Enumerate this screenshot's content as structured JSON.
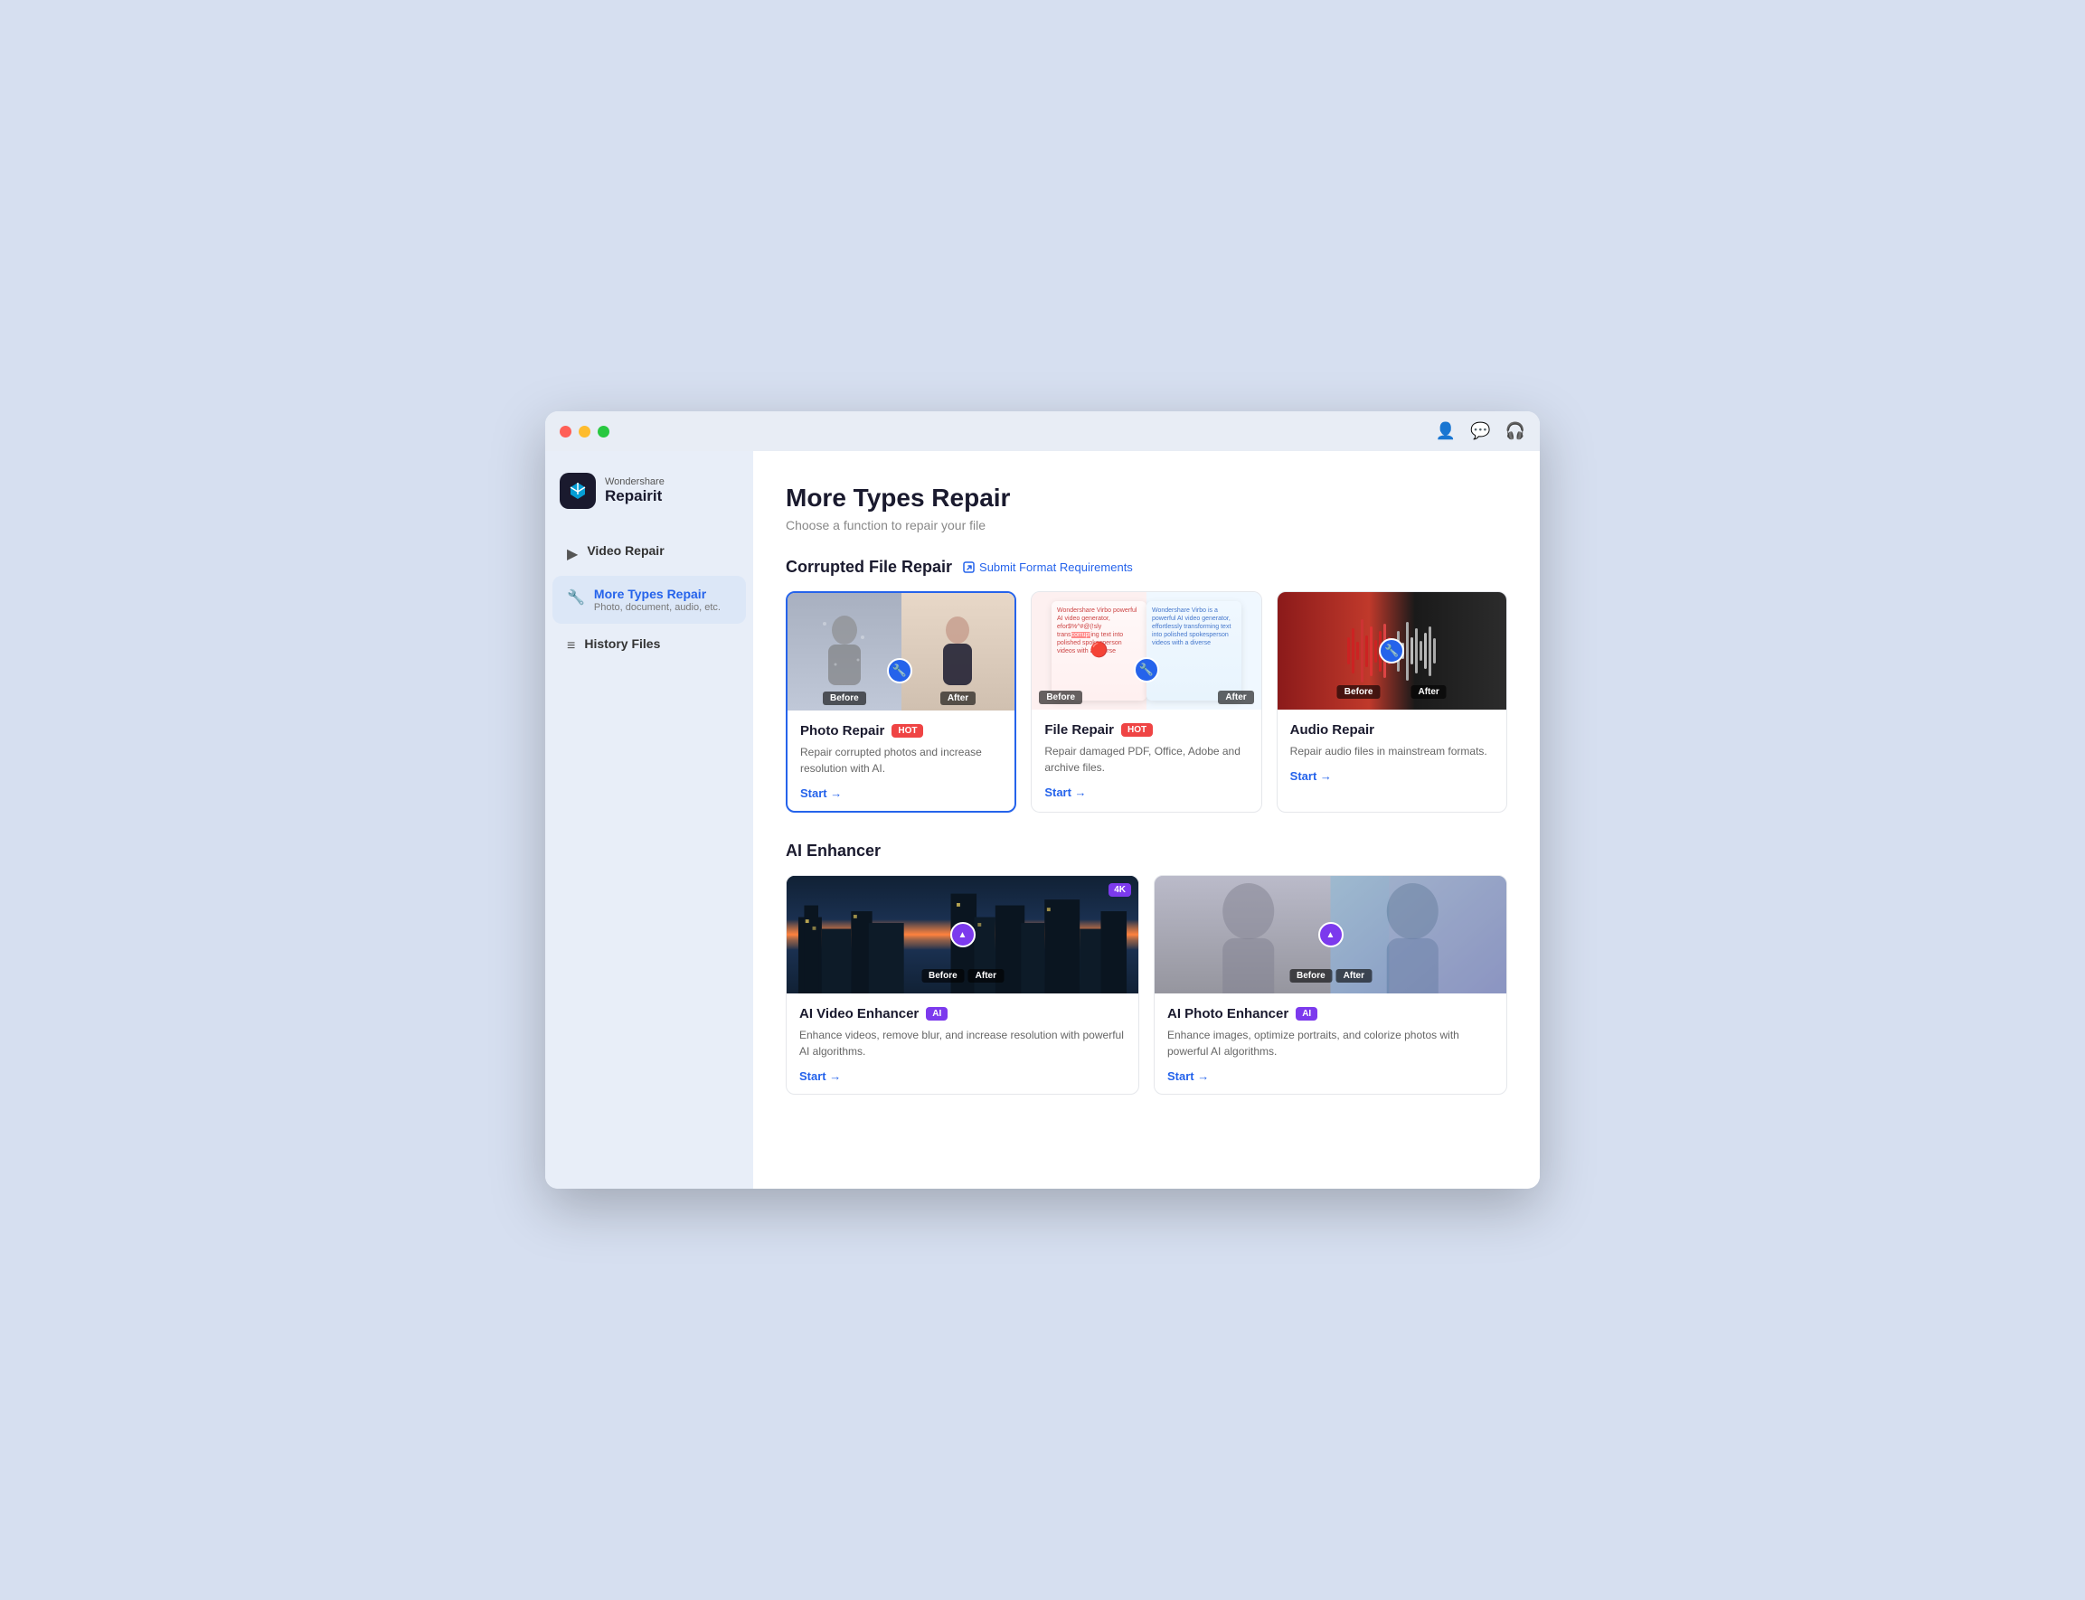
{
  "window": {
    "title": "Wondershare Repairit"
  },
  "logo": {
    "brand": "Wondershare",
    "name": "Repairit"
  },
  "sidebar": {
    "items": [
      {
        "id": "video-repair",
        "label": "Video Repair",
        "sublabel": "",
        "active": false,
        "icon": "▶"
      },
      {
        "id": "more-types-repair",
        "label": "More Types Repair",
        "sublabel": "Photo, document, audio, etc.",
        "active": true,
        "icon": "🔧"
      },
      {
        "id": "history-files",
        "label": "History Files",
        "sublabel": "",
        "active": false,
        "icon": "≡"
      }
    ]
  },
  "main": {
    "title": "More Types Repair",
    "subtitle": "Choose a function to repair your file",
    "sections": [
      {
        "id": "corrupted-file-repair",
        "title": "Corrupted File Repair",
        "submit_link": "Submit Format Requirements",
        "cards": [
          {
            "id": "photo-repair",
            "title": "Photo Repair",
            "badge": "HOT",
            "badge_type": "hot",
            "desc": "Repair corrupted photos and increase resolution with AI.",
            "start_label": "Start →",
            "selected": true
          },
          {
            "id": "file-repair",
            "title": "File Repair",
            "badge": "HOT",
            "badge_type": "hot",
            "desc": "Repair damaged PDF, Office, Adobe and archive files.",
            "start_label": "Start →",
            "selected": false
          },
          {
            "id": "audio-repair",
            "title": "Audio Repair",
            "badge": "",
            "badge_type": "",
            "desc": "Repair audio files in mainstream formats.",
            "start_label": "Start →",
            "selected": false
          }
        ]
      },
      {
        "id": "ai-enhancer",
        "title": "AI Enhancer",
        "cards": [
          {
            "id": "ai-video-enhancer",
            "title": "AI Video Enhancer",
            "badge": "AI",
            "badge_type": "ai",
            "desc": "Enhance videos, remove blur, and increase resolution with powerful AI algorithms.",
            "start_label": "Start →"
          },
          {
            "id": "ai-photo-enhancer",
            "title": "AI Photo Enhancer",
            "badge": "AI",
            "badge_type": "ai",
            "desc": "Enhance images, optimize portraits, and colorize photos with powerful AI algorithms.",
            "start_label": "Start →"
          }
        ]
      }
    ]
  },
  "titlebar": {
    "icons": [
      "user-icon",
      "chat-icon",
      "headset-icon"
    ]
  }
}
